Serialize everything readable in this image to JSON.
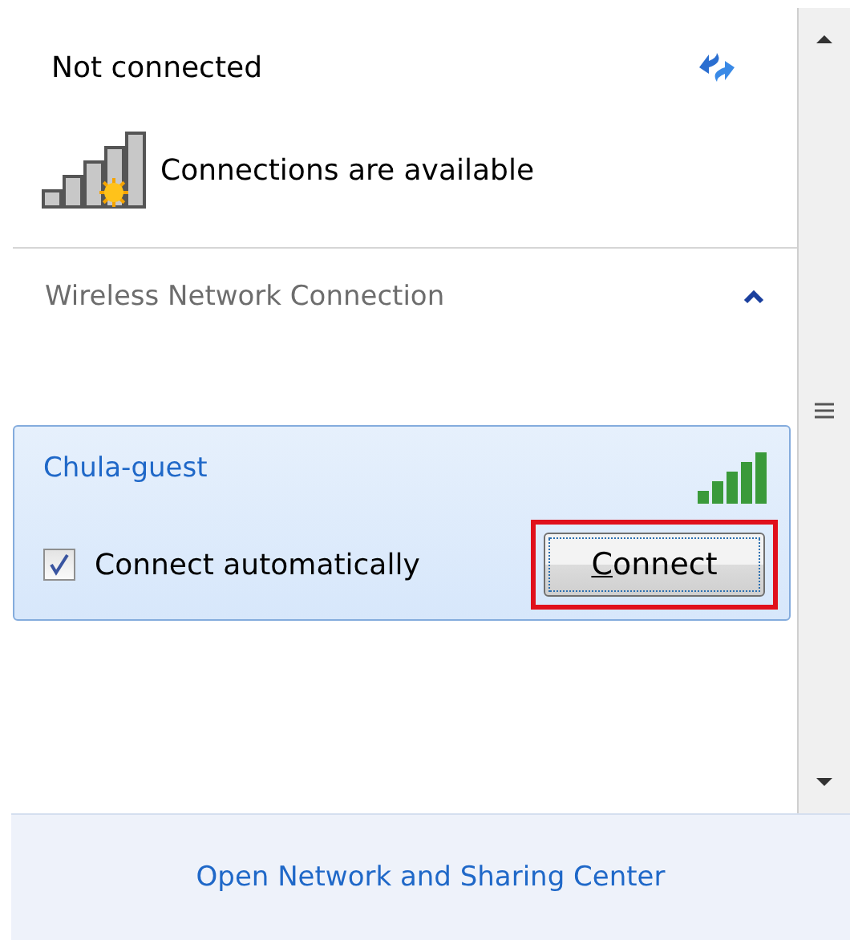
{
  "status": {
    "title": "Not connected",
    "message": "Connections are available"
  },
  "section": {
    "title": "Wireless Network Connection",
    "expanded": true
  },
  "networks": [
    {
      "name": "Chula-guest",
      "selected": true,
      "connect_automatically": true,
      "auto_label": "Connect automatically",
      "button": "Connect",
      "highlighted": true
    }
  ],
  "footer": {
    "link": "Open Network and Sharing Center"
  }
}
